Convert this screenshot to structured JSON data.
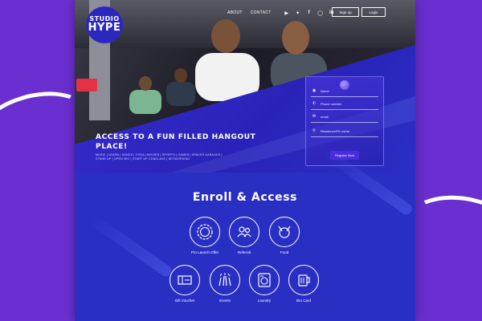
{
  "brand": {
    "line1": "STUDIO",
    "line2": "HYPE"
  },
  "nav": {
    "links": [
      "ABOUT",
      "CONTACT"
    ],
    "social_icons": [
      "youtube-icon",
      "twitter-icon",
      "facebook-icon",
      "instagram-icon",
      "linkedin-icon"
    ],
    "signup_label": "Sign up",
    "login_label": "Login"
  },
  "hero": {
    "title": "ACCESS TO A FUN FILLED HANGOUT PLACE!",
    "subtitle": "MUSIC | LEARN | DANCE | YOGA | MOVIES | SPORTS | GAMES | SPACES KARAOKE | STAND UP | OPEN MIC | START UP CONCLAVE | NETWORKING"
  },
  "form": {
    "name_placeholder": "Name",
    "phone_placeholder": "Phone number",
    "email_placeholder": "email",
    "residence_placeholder": "Residence/Pb name",
    "register_label": "Register Now"
  },
  "section": {
    "title": "Enroll & Access"
  },
  "features": [
    {
      "label": "Pro Launch Offer",
      "icon": "offer-badge-icon"
    },
    {
      "label": "Referral",
      "icon": "referral-icon"
    },
    {
      "label": "Food",
      "icon": "food-icon"
    },
    {
      "label": "Gift Voucher",
      "icon": "gift-voucher-icon"
    },
    {
      "label": "Events",
      "icon": "events-icon"
    },
    {
      "label": "Laundry",
      "icon": "laundry-icon"
    },
    {
      "label": "Bro Card",
      "icon": "mug-icon"
    }
  ],
  "colors": {
    "outer_background": "#6a2fd0",
    "page_background": "#2a2fc4",
    "accent": "#4a2be0",
    "text": "#ffffff"
  }
}
